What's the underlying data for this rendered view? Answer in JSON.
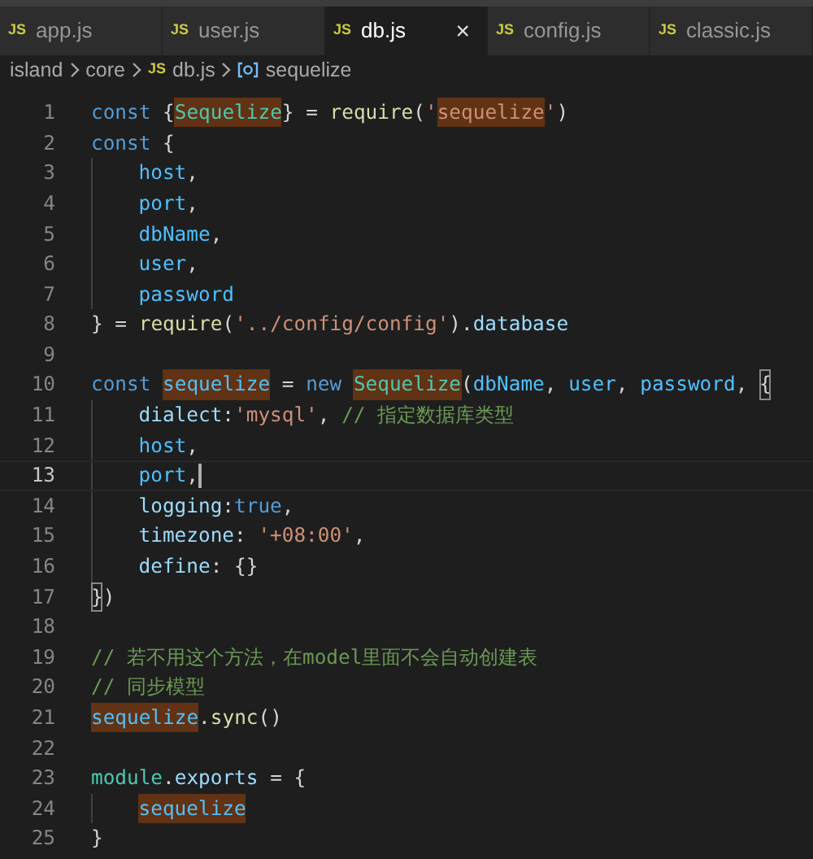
{
  "tabs": [
    {
      "icon": "JS",
      "label": "app.js",
      "selected": false
    },
    {
      "icon": "JS",
      "label": "user.js",
      "selected": false
    },
    {
      "icon": "JS",
      "label": "db.js",
      "selected": true,
      "close": "×"
    },
    {
      "icon": "JS",
      "label": "config.js",
      "selected": false
    },
    {
      "icon": "JS",
      "label": "classic.js",
      "selected": false
    }
  ],
  "breadcrumb": [
    {
      "kind": "folder",
      "label": "island"
    },
    {
      "kind": "folder",
      "label": "core"
    },
    {
      "kind": "file",
      "icon": "JS",
      "label": "db.js"
    },
    {
      "kind": "symbol",
      "label": "sequelize"
    }
  ],
  "lines": [
    {
      "number": "1",
      "current": false,
      "indented": false,
      "tokens": [
        {
          "kind": "keyword",
          "text": "const",
          "highlighted": false
        },
        {
          "kind": "punct",
          "text": " {",
          "highlighted": false
        },
        {
          "kind": "class",
          "text": "Sequelize",
          "highlighted": true
        },
        {
          "kind": "punct",
          "text": "} = ",
          "highlighted": false
        },
        {
          "kind": "function",
          "text": "require",
          "highlighted": false
        },
        {
          "kind": "punct",
          "text": "(",
          "highlighted": false
        },
        {
          "kind": "string",
          "text": "'",
          "highlighted": false
        },
        {
          "kind": "string",
          "text": "sequelize",
          "highlighted": true
        },
        {
          "kind": "string",
          "text": "'",
          "highlighted": false
        },
        {
          "kind": "punct",
          "text": ")",
          "highlighted": false
        }
      ]
    },
    {
      "number": "2",
      "current": false,
      "indented": false,
      "tokens": [
        {
          "kind": "keyword",
          "text": "const",
          "highlighted": false
        },
        {
          "kind": "punct",
          "text": " {",
          "highlighted": false
        }
      ]
    },
    {
      "number": "3",
      "current": false,
      "indented": true,
      "tokens": [
        {
          "kind": "variable",
          "text": "host",
          "highlighted": false
        },
        {
          "kind": "punct",
          "text": ",",
          "highlighted": false
        }
      ]
    },
    {
      "number": "4",
      "current": false,
      "indented": true,
      "tokens": [
        {
          "kind": "variable",
          "text": "port",
          "highlighted": false
        },
        {
          "kind": "punct",
          "text": ",",
          "highlighted": false
        }
      ]
    },
    {
      "number": "5",
      "current": false,
      "indented": true,
      "tokens": [
        {
          "kind": "variable",
          "text": "dbName",
          "highlighted": false
        },
        {
          "kind": "punct",
          "text": ",",
          "highlighted": false
        }
      ]
    },
    {
      "number": "6",
      "current": false,
      "indented": true,
      "tokens": [
        {
          "kind": "variable",
          "text": "user",
          "highlighted": false
        },
        {
          "kind": "punct",
          "text": ",",
          "highlighted": false
        }
      ]
    },
    {
      "number": "7",
      "current": false,
      "indented": true,
      "tokens": [
        {
          "kind": "variable",
          "text": "password",
          "highlighted": false
        }
      ]
    },
    {
      "number": "8",
      "current": false,
      "indented": false,
      "tokens": [
        {
          "kind": "punct",
          "text": "} = ",
          "highlighted": false
        },
        {
          "kind": "function",
          "text": "require",
          "highlighted": false
        },
        {
          "kind": "punct",
          "text": "(",
          "highlighted": false
        },
        {
          "kind": "string",
          "text": "'../config/config'",
          "highlighted": false
        },
        {
          "kind": "punct",
          "text": ").",
          "highlighted": false
        },
        {
          "kind": "property",
          "text": "database",
          "highlighted": false
        }
      ]
    },
    {
      "number": "9",
      "current": false,
      "indented": false
    },
    {
      "number": "10",
      "current": false,
      "indented": false,
      "tokens": [
        {
          "kind": "keyword",
          "text": "const ",
          "highlighted": false
        },
        {
          "kind": "variable",
          "text": "sequelize",
          "highlighted": true
        },
        {
          "kind": "punct",
          "text": " = ",
          "highlighted": false
        },
        {
          "kind": "keyword",
          "text": "new ",
          "highlighted": false
        },
        {
          "kind": "class",
          "text": "Sequelize",
          "highlighted": true
        },
        {
          "kind": "punct",
          "text": "(",
          "highlighted": false
        },
        {
          "kind": "variable",
          "text": "dbName",
          "highlighted": false
        },
        {
          "kind": "punct",
          "text": ", ",
          "highlighted": false
        },
        {
          "kind": "variable",
          "text": "user",
          "highlighted": false
        },
        {
          "kind": "punct",
          "text": ", ",
          "highlighted": false
        },
        {
          "kind": "variable",
          "text": "password",
          "highlighted": false
        },
        {
          "kind": "punct",
          "text": ", ",
          "highlighted": false
        },
        {
          "kind": "matched_bracket",
          "text": "{",
          "highlighted": false
        }
      ]
    },
    {
      "number": "11",
      "current": false,
      "indented": true,
      "tokens": [
        {
          "kind": "property",
          "text": "dialect",
          "highlighted": false
        },
        {
          "kind": "punct",
          "text": ":",
          "highlighted": false
        },
        {
          "kind": "string",
          "text": "'mysql'",
          "highlighted": false
        },
        {
          "kind": "punct",
          "text": ", ",
          "highlighted": false
        },
        {
          "kind": "comment",
          "text": "// 指定数据库类型",
          "highlighted": false
        }
      ]
    },
    {
      "number": "12",
      "current": false,
      "indented": true,
      "tokens": [
        {
          "kind": "variable",
          "text": "host",
          "highlighted": false
        },
        {
          "kind": "punct",
          "text": ",",
          "highlighted": false
        }
      ]
    },
    {
      "number": "13",
      "current": true,
      "indented": true,
      "tokens": [
        {
          "kind": "variable",
          "text": "port",
          "highlighted": false
        },
        {
          "kind": "punct",
          "text": ",",
          "highlighted": false
        }
      ]
    },
    {
      "number": "14",
      "current": false,
      "indented": true,
      "tokens": [
        {
          "kind": "property",
          "text": "logging",
          "highlighted": false
        },
        {
          "kind": "punct",
          "text": ":",
          "highlighted": false
        },
        {
          "kind": "keyword",
          "text": "true",
          "highlighted": false
        },
        {
          "kind": "punct",
          "text": ",",
          "highlighted": false
        }
      ]
    },
    {
      "number": "15",
      "current": false,
      "indented": true,
      "tokens": [
        {
          "kind": "property",
          "text": "timezone",
          "highlighted": false
        },
        {
          "kind": "punct",
          "text": ": ",
          "highlighted": false
        },
        {
          "kind": "string",
          "text": "'+08:00'",
          "highlighted": false
        },
        {
          "kind": "punct",
          "text": ",",
          "highlighted": false
        }
      ]
    },
    {
      "number": "16",
      "current": false,
      "indented": true,
      "tokens": [
        {
          "kind": "property",
          "text": "define",
          "highlighted": false
        },
        {
          "kind": "punct",
          "text": ": {}",
          "highlighted": false
        }
      ]
    },
    {
      "number": "17",
      "current": false,
      "indented": false,
      "tokens": [
        {
          "kind": "matched_bracket",
          "text": "}",
          "highlighted": false
        },
        {
          "kind": "punct",
          "text": ")",
          "highlighted": false
        }
      ]
    },
    {
      "number": "18",
      "current": false,
      "indented": false
    },
    {
      "number": "19",
      "current": false,
      "indented": false,
      "tokens": [
        {
          "kind": "comment",
          "text": "// 若不用这个方法，在model里面不会自动创建表",
          "highlighted": false
        }
      ]
    },
    {
      "number": "20",
      "current": false,
      "indented": false,
      "tokens": [
        {
          "kind": "comment",
          "text": "// 同步模型",
          "highlighted": false
        }
      ]
    },
    {
      "number": "21",
      "current": false,
      "indented": false,
      "tokens": [
        {
          "kind": "variable",
          "text": "sequelize",
          "highlighted": true
        },
        {
          "kind": "punct",
          "text": ".",
          "highlighted": false
        },
        {
          "kind": "function",
          "text": "sync",
          "highlighted": false
        },
        {
          "kind": "punct",
          "text": "()",
          "highlighted": false
        }
      ]
    },
    {
      "number": "22",
      "current": false,
      "indented": false
    },
    {
      "number": "23",
      "current": false,
      "indented": false,
      "tokens": [
        {
          "kind": "class",
          "text": "module",
          "highlighted": false
        },
        {
          "kind": "punct",
          "text": ".",
          "highlighted": false
        },
        {
          "kind": "property",
          "text": "exports",
          "highlighted": false
        },
        {
          "kind": "punct",
          "text": " = {",
          "highlighted": false
        }
      ]
    },
    {
      "number": "24",
      "current": false,
      "indented": true,
      "tokens": [
        {
          "kind": "variable",
          "text": "sequelize",
          "highlighted": true
        }
      ]
    },
    {
      "number": "25",
      "current": false,
      "indented": false,
      "tokens": [
        {
          "kind": "punct",
          "text": "}",
          "highlighted": false
        }
      ]
    }
  ]
}
